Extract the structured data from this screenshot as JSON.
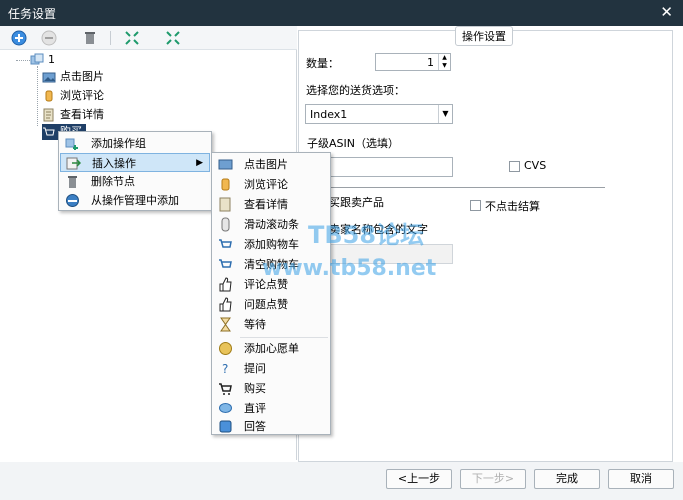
{
  "window": {
    "title": "任务设置",
    "close_label": "✕"
  },
  "toolbar": {
    "icons": [
      "add-icon",
      "remove-icon",
      "delete-icon",
      "expand-icon",
      "collapse-icon"
    ]
  },
  "tree": {
    "root_label": "1",
    "items": [
      "点击图片",
      "浏览评论",
      "查看详情",
      "购买"
    ]
  },
  "context_menu": {
    "items": [
      "添加操作组",
      "插入操作",
      "删除节点",
      "从操作管理中添加"
    ],
    "highlighted_index": 1,
    "arrow": "▶"
  },
  "submenu": {
    "group1": [
      "点击图片",
      "浏览评论",
      "查看详情",
      "滑动滚动条",
      "添加购物车",
      "清空购物车",
      "评论点赞",
      "问题点赞",
      "等待"
    ],
    "group2": [
      "添加心愿单",
      "提问",
      "购买",
      "直评",
      "回答"
    ]
  },
  "settings": {
    "group_title": "操作设置",
    "quantity_label": "数量：",
    "quantity_value": "1",
    "shipping_label": "选择您的送货选项：",
    "shipping_value": "Index1",
    "child_asin_label": "子级ASIN（选填）",
    "child_asin_value": "",
    "cvs_label": "CVS",
    "buy_label": "买跟卖产品",
    "no_checkout_label": "不点击结算",
    "seller_name_label": "卖家名称包含的文字"
  },
  "footer": {
    "prev_label": "<上一步",
    "next_label": "下一步>",
    "finish_label": "完成",
    "cancel_label": "取消"
  },
  "watermark": {
    "line1": "TB58论坛",
    "line2": "www.tb58.net"
  },
  "colors": {
    "titlebar": "#22333f",
    "highlight": "#cfe6f8",
    "watermark": "#3aa0e6"
  }
}
